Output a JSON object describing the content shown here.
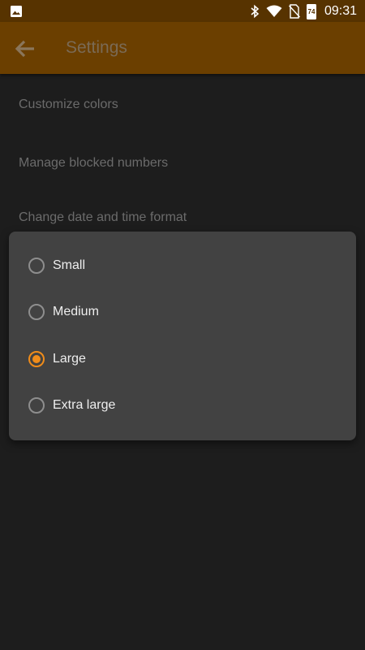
{
  "status_bar": {
    "time": "09:31",
    "battery_level": "74",
    "icons": [
      "image-icon",
      "bluetooth-icon",
      "wifi-icon",
      "no-sim-icon",
      "battery-icon"
    ]
  },
  "app_bar": {
    "title": "Settings",
    "back_icon": "arrow-left-icon"
  },
  "settings": {
    "items": [
      {
        "label": "Customize colors"
      },
      {
        "label": "Manage blocked numbers"
      },
      {
        "label": "Change date and time format"
      }
    ]
  },
  "dialog": {
    "options": [
      {
        "label": "Small",
        "selected": false
      },
      {
        "label": "Medium",
        "selected": false
      },
      {
        "label": "Large",
        "selected": true
      },
      {
        "label": "Extra large",
        "selected": false
      }
    ]
  },
  "colors": {
    "accent": "#f08c1a",
    "app_bar": "#6b3f00",
    "status_bar": "#573300",
    "background": "#1d1d1d",
    "dialog": "#424242"
  }
}
